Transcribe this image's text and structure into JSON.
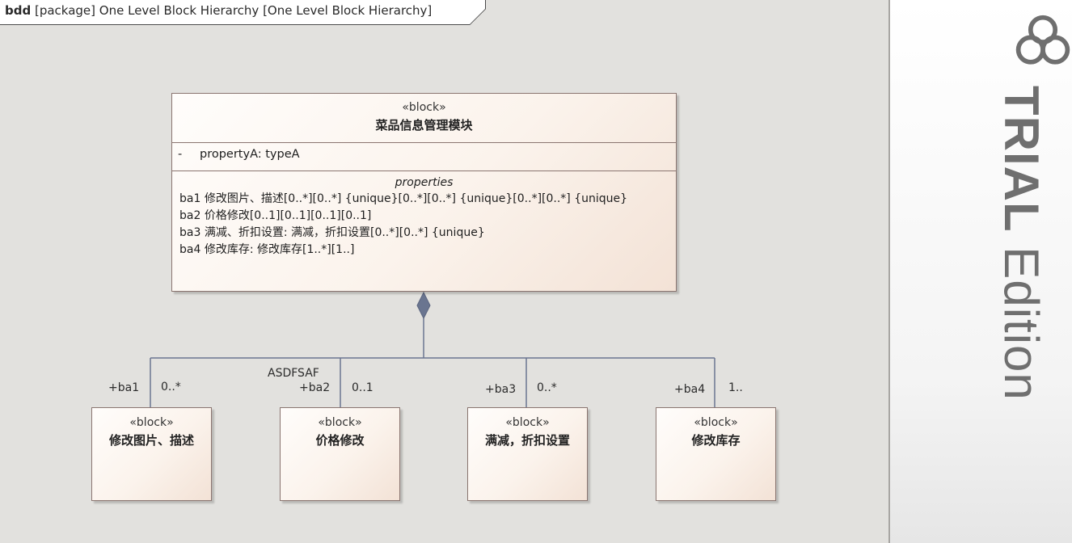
{
  "frame": {
    "kind": "bdd",
    "rest": " [package] One Level Block Hierarchy [One Level Block Hierarchy]"
  },
  "main_block": {
    "stereotype": "«block»",
    "name": "菜品信息管理模块",
    "attribute": {
      "visibility": "-",
      "text": "propertyA: typeA"
    },
    "properties_title": "properties",
    "properties": [
      "ba1 修改图片、描述[0..*][0..*] {unique}[0..*][0..*] {unique}[0..*][0..*] {unique}",
      "ba2 价格修改[0..1][0..1][0..1][0..1]",
      "ba3 满减、折扣设置: 满减，折扣设置[0..*][0..*] {unique}",
      "ba4 修改库存: 修改库存[1..*][1..]"
    ]
  },
  "children": [
    {
      "stereotype": "«block»",
      "name": "修改图片、描述",
      "role": "+ba1",
      "multiplicity": "0..*"
    },
    {
      "stereotype": "«block»",
      "name": "价格修改",
      "role": "+ba2",
      "multiplicity": "0..1",
      "assoc_label": "ASDFSAF"
    },
    {
      "stereotype": "«block»",
      "name": "满减，折扣设置",
      "role": "+ba3",
      "multiplicity": "0..*"
    },
    {
      "stereotype": "«block»",
      "name": "修改库存",
      "role": "+ba4",
      "multiplicity": "1.."
    }
  ],
  "watermark": {
    "bold": "TRIAL",
    "rest": " Edition",
    "logo": "trial-logo-icon"
  },
  "colors": {
    "background": "#e2e1de",
    "connector": "#6a7590",
    "block_border": "#8a7570",
    "watermark": "#6f6f6f"
  }
}
